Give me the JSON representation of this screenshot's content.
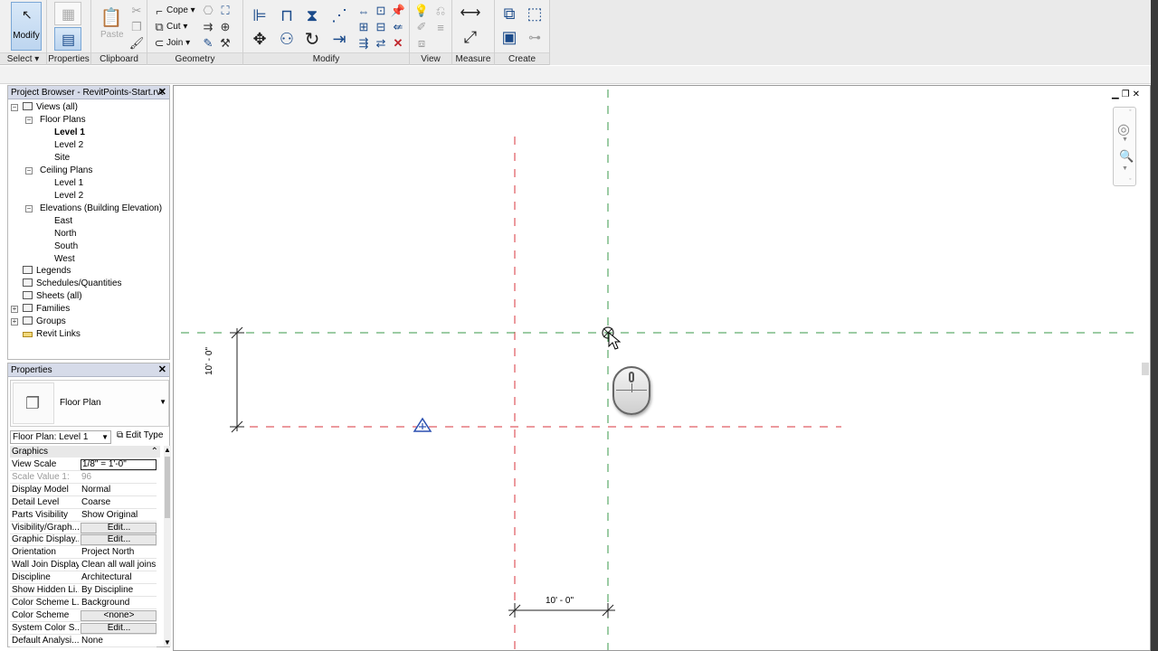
{
  "ribbon": {
    "panels": {
      "select": "Select",
      "properties": "Properties",
      "clipboard": "Clipboard",
      "geometry": "Geometry",
      "modify": "Modify",
      "view": "View",
      "measure": "Measure",
      "create": "Create"
    },
    "modify_label": "Modify",
    "paste_label": "Paste",
    "cope_label": "Cope",
    "cut_label": "Cut",
    "join_label": "Join"
  },
  "project_browser": {
    "title": "Project Browser - RevitPoints-Start.rvt",
    "items": [
      {
        "label": "Views (all)"
      },
      {
        "label": "Floor Plans"
      },
      {
        "label": "Level 1"
      },
      {
        "label": "Level 2"
      },
      {
        "label": "Site"
      },
      {
        "label": "Ceiling Plans"
      },
      {
        "label": "Level 1"
      },
      {
        "label": "Level 2"
      },
      {
        "label": "Elevations (Building Elevation)"
      },
      {
        "label": "East"
      },
      {
        "label": "North"
      },
      {
        "label": "South"
      },
      {
        "label": "West"
      },
      {
        "label": "Legends"
      },
      {
        "label": "Schedules/Quantities"
      },
      {
        "label": "Sheets (all)"
      },
      {
        "label": "Families"
      },
      {
        "label": "Groups"
      },
      {
        "label": "Revit Links"
      }
    ]
  },
  "properties": {
    "title": "Properties",
    "type_name": "Floor Plan",
    "instance_selector": "Floor Plan: Level 1",
    "edit_type": "Edit Type",
    "group": "Graphics",
    "rows": [
      {
        "k": "View Scale",
        "v": "1/8\" = 1'-0\""
      },
      {
        "k": "Scale Value    1:",
        "v": "96"
      },
      {
        "k": "Display Model",
        "v": "Normal"
      },
      {
        "k": "Detail Level",
        "v": "Coarse"
      },
      {
        "k": "Parts Visibility",
        "v": "Show Original"
      },
      {
        "k": "Visibility/Graph...",
        "v": "Edit..."
      },
      {
        "k": "Graphic Display...",
        "v": "Edit..."
      },
      {
        "k": "Orientation",
        "v": "Project North"
      },
      {
        "k": "Wall Join Display",
        "v": "Clean all wall joins"
      },
      {
        "k": "Discipline",
        "v": "Architectural"
      },
      {
        "k": "Show Hidden Li...",
        "v": "By Discipline"
      },
      {
        "k": "Color Scheme L...",
        "v": "Background"
      },
      {
        "k": "Color Scheme",
        "v": "<none>"
      },
      {
        "k": "System Color S...",
        "v": "Edit..."
      },
      {
        "k": "Default Analysi...",
        "v": "None"
      }
    ]
  },
  "canvas": {
    "dim_vertical": "10' - 0\"",
    "dim_horizontal": "10' - 0\"",
    "colors": {
      "red_line": "#d9363e",
      "green_line": "#3a9a4a",
      "marker_blue": "#2a4fb0"
    }
  }
}
